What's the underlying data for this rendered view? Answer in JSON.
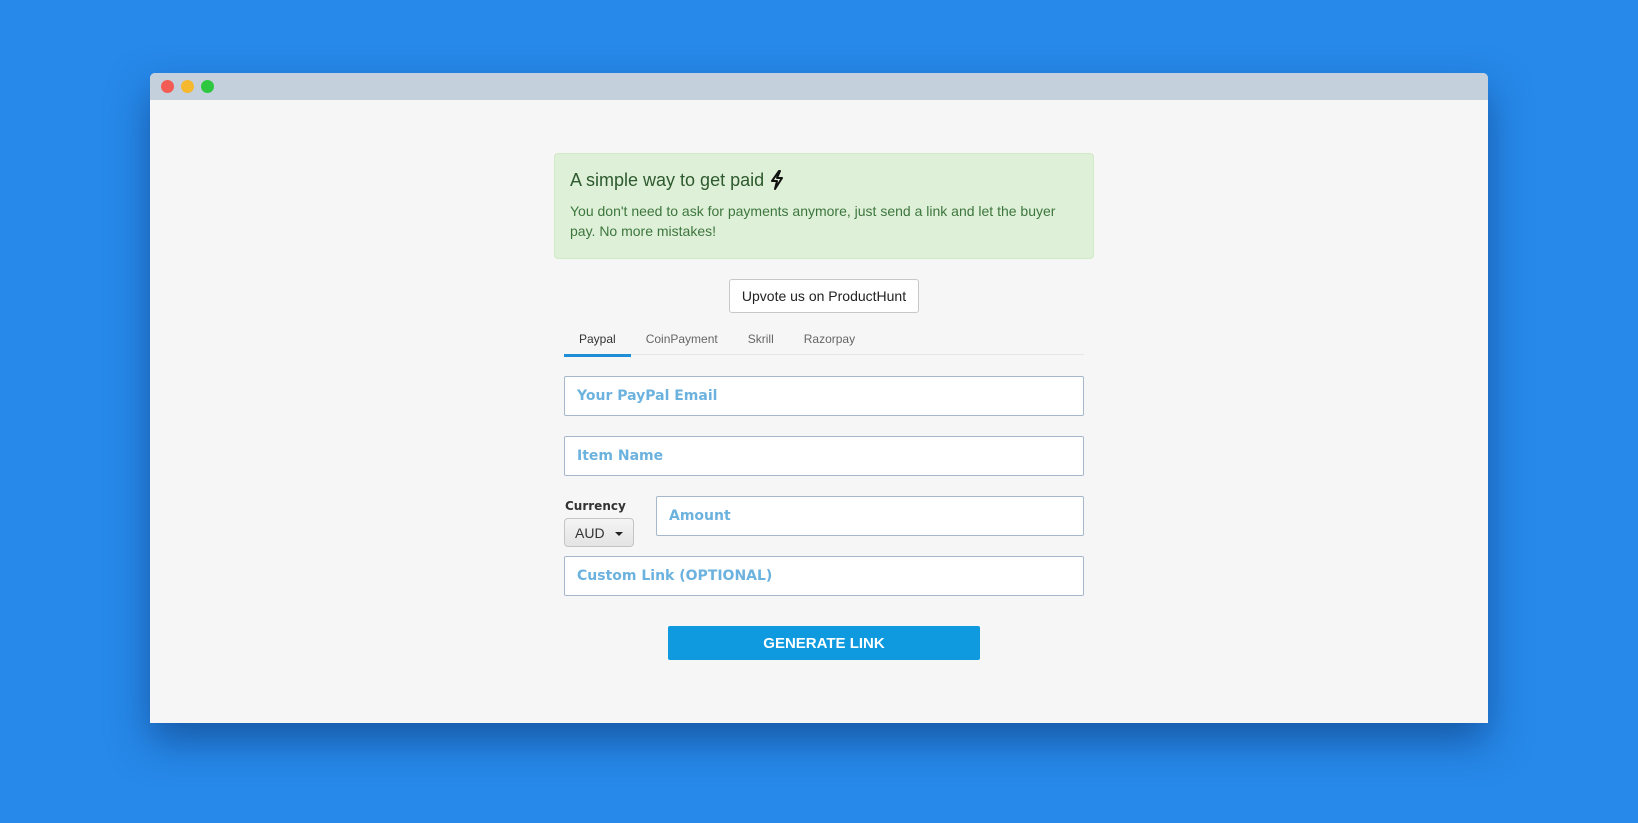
{
  "window": {
    "controls": [
      "close",
      "minimize",
      "maximize"
    ]
  },
  "alert": {
    "title": "A simple way to get paid",
    "icon": "lightning-bolt-icon",
    "text": "You don't need to ask for payments anymore, just send a link and let the buyer pay. No more mistakes!"
  },
  "upvote_button": {
    "label": "Upvote us on ProductHunt"
  },
  "tabs": [
    {
      "label": "Paypal",
      "active": true
    },
    {
      "label": "CoinPayment",
      "active": false
    },
    {
      "label": "Skrill",
      "active": false
    },
    {
      "label": "Razorpay",
      "active": false
    }
  ],
  "form": {
    "email": {
      "placeholder": "Your PayPal Email",
      "value": ""
    },
    "item_name": {
      "placeholder": "Item Name",
      "value": ""
    },
    "currency": {
      "label": "Currency",
      "selected": "AUD"
    },
    "amount": {
      "placeholder": "Amount",
      "value": ""
    },
    "custom_link": {
      "placeholder": "Custom Link (OPTIONAL)",
      "value": ""
    }
  },
  "generate_button": {
    "label": "GENERATE LINK"
  },
  "colors": {
    "background": "#2789ea",
    "accent": "#0f9ae0",
    "alert_bg": "#dff0d8",
    "placeholder": "#6cb2de"
  }
}
